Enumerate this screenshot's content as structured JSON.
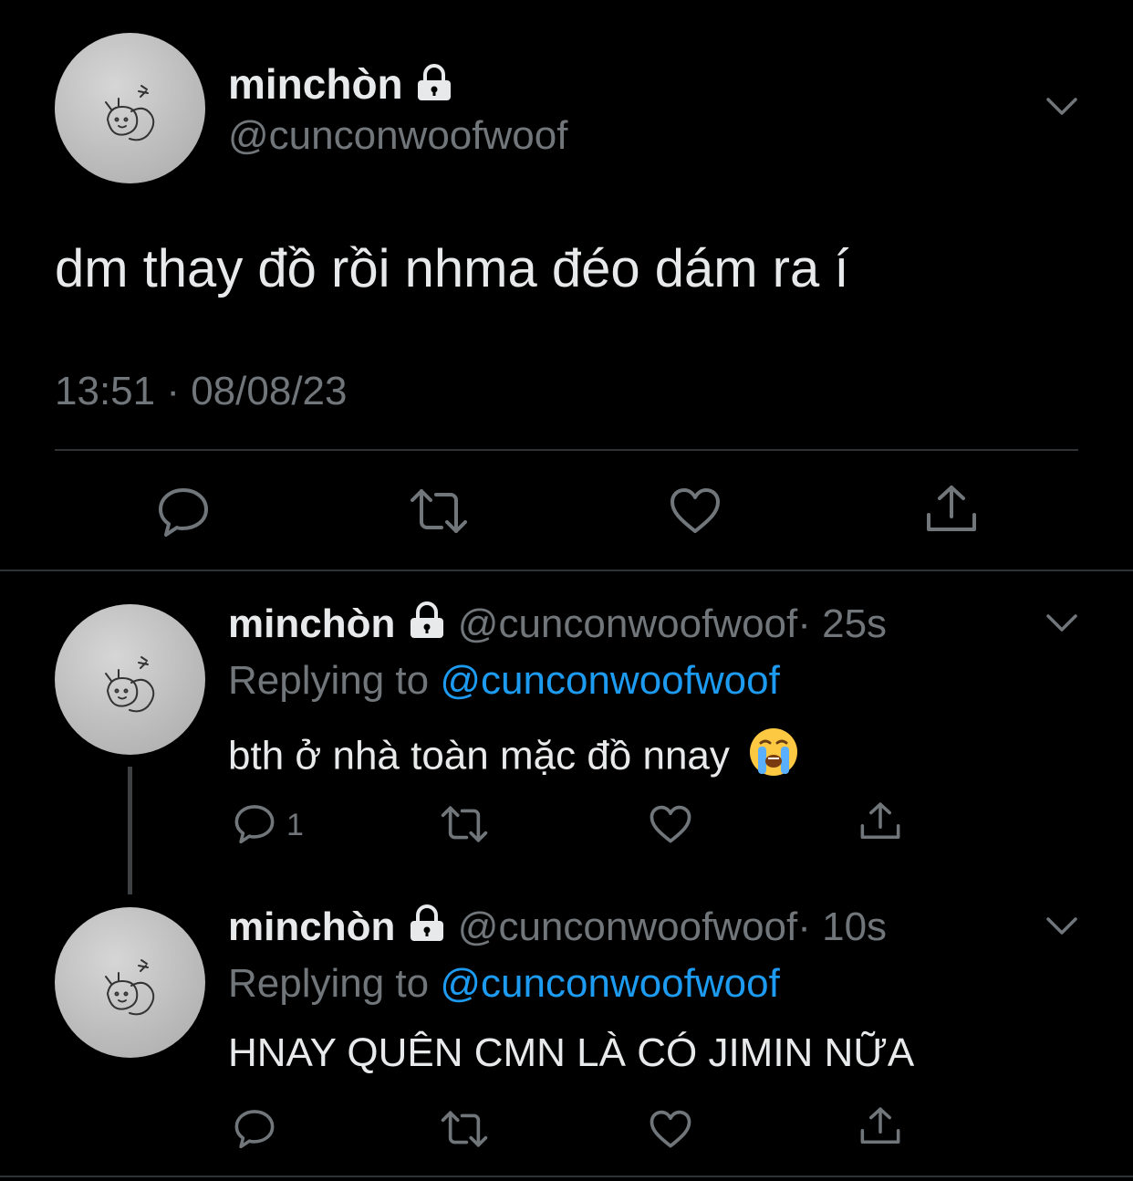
{
  "main_tweet": {
    "display_name": "minchòn",
    "handle": "@cunconwoofwoof",
    "text": "dm thay đồ rồi nhma đéo dám ra í",
    "timestamp": "13:51 · 08/08/23",
    "actions": [
      "reply-icon",
      "retweet-icon",
      "like-icon",
      "share-icon"
    ]
  },
  "replies": [
    {
      "display_name": "minchòn",
      "handle": "@cunconwoofwoof",
      "time": "· 25s",
      "replying_prefix": "Replying to",
      "replying_to": "@cunconwoofwoof",
      "text": "bth ở nhà toàn mặc đồ nnay",
      "emoji": "😭",
      "reply_count": "1"
    },
    {
      "display_name": "minchòn",
      "handle": "@cunconwoofwoof",
      "time": "· 10s",
      "replying_prefix": "Replying to",
      "replying_to": "@cunconwoofwoof",
      "text": "HNAY QUÊN CMN LÀ CÓ JIMIN NỮA",
      "reply_count": ""
    }
  ],
  "colors": {
    "background": "#000000",
    "text": "#e7e9ea",
    "muted": "#71767b",
    "link": "#1d9bf0",
    "divider": "#2f3336"
  }
}
